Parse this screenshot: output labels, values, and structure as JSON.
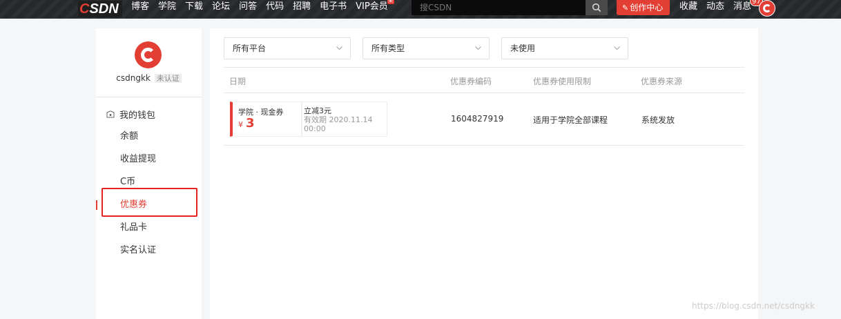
{
  "nav": {
    "logo_prefix": "C",
    "logo_text": "SDN",
    "links": [
      "博客",
      "学院",
      "下载",
      "论坛",
      "问答",
      "代码",
      "招聘",
      "电子书",
      "VIP会员"
    ],
    "vip_badge": "荣",
    "search_placeholder": "搜CSDN",
    "create_label": "创作中心",
    "right_links": [
      "收藏",
      "动态",
      "消息"
    ],
    "message_count": "97"
  },
  "sidebar": {
    "username": "csdngkk",
    "cert_status": "未认证",
    "wallet_title": "我的钱包",
    "items": [
      "余额",
      "收益提现",
      "C币",
      "优惠券",
      "礼品卡",
      "实名认证"
    ],
    "active_item": "优惠券"
  },
  "filters": {
    "platform": "所有平台",
    "type": "所有类型",
    "status": "未使用"
  },
  "table": {
    "headers": [
      "日期",
      "优惠券编码",
      "优惠券使用限制",
      "优惠券来源"
    ],
    "rows": [
      {
        "coupon_type": "学院 · 现金券",
        "currency": "¥",
        "amount": "3",
        "discount": "立减3元",
        "validity": "有效期 2020.11.14 00:00",
        "code": "1604827919",
        "restriction": "适用于学院全部课程",
        "source": "系统发放"
      }
    ]
  },
  "watermark": "https://blog.csdn.net/csdngkk",
  "colors": {
    "brand_red": "#e33e33",
    "nav_bg": "#26282b",
    "highlight_red": "#e5221f"
  }
}
